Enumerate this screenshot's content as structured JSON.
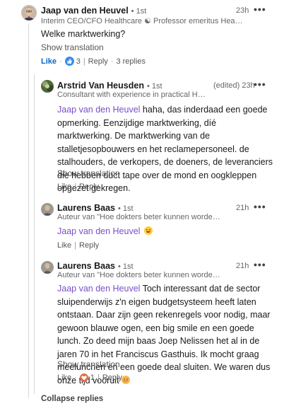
{
  "comment": {
    "author": "Jaap van den Heuvel",
    "degree": "• 1st",
    "headline": "Interim CEO/CFO Healthcare ☯ Professor emeritus Healthcare Man...",
    "time": "23h",
    "text": "Welke marktwerking?",
    "show_translation": "Show translation",
    "like_label": "Like",
    "like_count": "3",
    "reply_label": "Reply",
    "replies_count": "3 replies"
  },
  "replies": [
    {
      "author": "Arstrid Van Heusden",
      "degree": "• 1st",
      "edited_time": "(edited) 23h",
      "headline": "Consultant with experience in practical Healthcare a...",
      "mention": "Jaap van den Heuvel",
      "text": " haha, das inderdaad een goede opmerking. Eenzijdige marktwerking, díé marktwerking. De marktwerking van de stalletjesopbouwers en het reclamepersoneel. de stalhouders, de verkopers, de doeners, de leveranciers die hebben duct tape over de mond en oogkleppen opgezet gekregen.",
      "show_translation": "Show translation",
      "like_label": "Like",
      "reply_label": "Reply"
    },
    {
      "author": "Laurens Baas",
      "degree": "• 1st",
      "time": "21h",
      "headline": "Auteur van \"Hoe dokters beter kunnen worden\" (nu ook als ...",
      "mention": "Jaap van den Heuvel",
      "like_label": "Like",
      "reply_label": "Reply"
    },
    {
      "author": "Laurens Baas",
      "degree": "• 1st",
      "time": "21h",
      "headline": "Auteur van \"Hoe dokters beter kunnen worden\" (nu ook als ...",
      "mention": "Jaap van den Heuvel",
      "text": " Toch interessant dat de sector sluipenderwijs z'n eigen budgetsysteem heeft laten ontstaan. Daar zijn geen rekenregels voor nodig, maar gewoon blauwe ogen, een big smile en een goede lunch. Zo deed mijn baas Joep Nelissen het al in de jaren 70 in het Franciscus Gasthuis. Ik mocht graag meelunchen en een goede deal sluiten. We waren dus onze tijd vooruit ",
      "show_translation": "Show translation",
      "like_label": "Like",
      "like_count": "1",
      "reply_label": "Reply"
    }
  ],
  "collapse_replies": "Collapse replies",
  "icons": {
    "more": "more-icon",
    "like_reaction": "thumbs-up-reaction-icon",
    "love_reaction": "heart-reaction-icon",
    "laugh_emoji": "laughing-emoji-icon",
    "sweat_emoji": "grin-sweat-emoji-icon"
  },
  "colors": {
    "mention": "#7a4fc7",
    "link_blue": "#0a66c2"
  }
}
